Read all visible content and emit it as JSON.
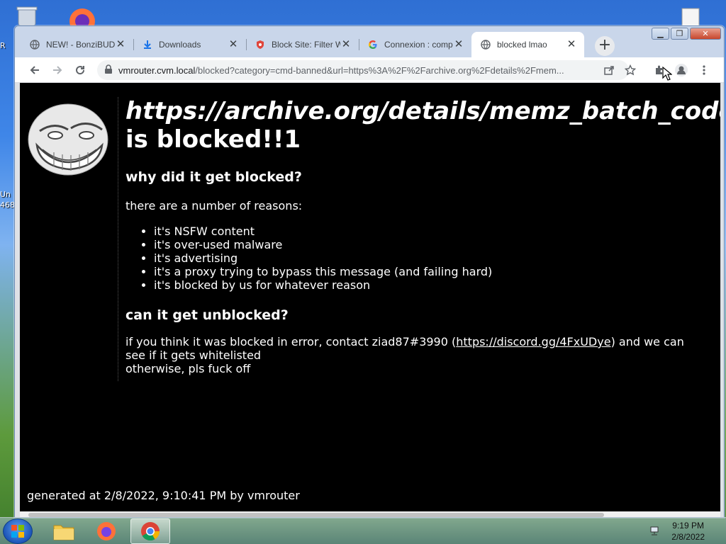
{
  "desktop": {
    "label_1": "R",
    "label_2": "Un",
    "label_3": "468"
  },
  "browser": {
    "tabs": [
      {
        "title": "NEW! - BonziBUDDY",
        "icon": "globe-icon",
        "active": false
      },
      {
        "title": "Downloads",
        "icon": "download-icon",
        "active": false
      },
      {
        "title": "Block Site: Filter W",
        "icon": "block-site-icon",
        "active": false
      },
      {
        "title": "Connexion : comp",
        "icon": "google-icon",
        "active": false
      },
      {
        "title": "blocked lmao",
        "icon": "globe-icon",
        "active": true
      }
    ],
    "new_tab_label": "+",
    "url_host": "vmrouter.cvm.local",
    "url_path": "/blocked?category=cmd-banned&url=https%3A%2F%2Farchive.org%2Fdetails%2Fmem..."
  },
  "page": {
    "blocked_url": "https://archive.org/details/memz_batch_code",
    "is_blocked": "is blocked!!1",
    "why_heading": "why did it get blocked?",
    "intro": "there are a number of reasons:",
    "reasons": [
      "it's NSFW content",
      "it's over-used malware",
      "it's advertising",
      "it's a proxy trying to bypass this message (and failing hard)",
      "it's blocked by us for whatever reason"
    ],
    "unblock_heading": "can it get unblocked?",
    "contact_prefix": "if you think it was blocked in error, contact ziad87#3990 (",
    "contact_link": "https://discord.gg/4FxUDye",
    "contact_suffix": ") and we can see if it gets whitelisted",
    "otherwise": "otherwise, pls fuck off",
    "footer": "generated at 2/8/2022, 9:10:41 PM by vmrouter"
  },
  "taskbar": {
    "time": "9:19 PM",
    "date": "2/8/2022"
  }
}
